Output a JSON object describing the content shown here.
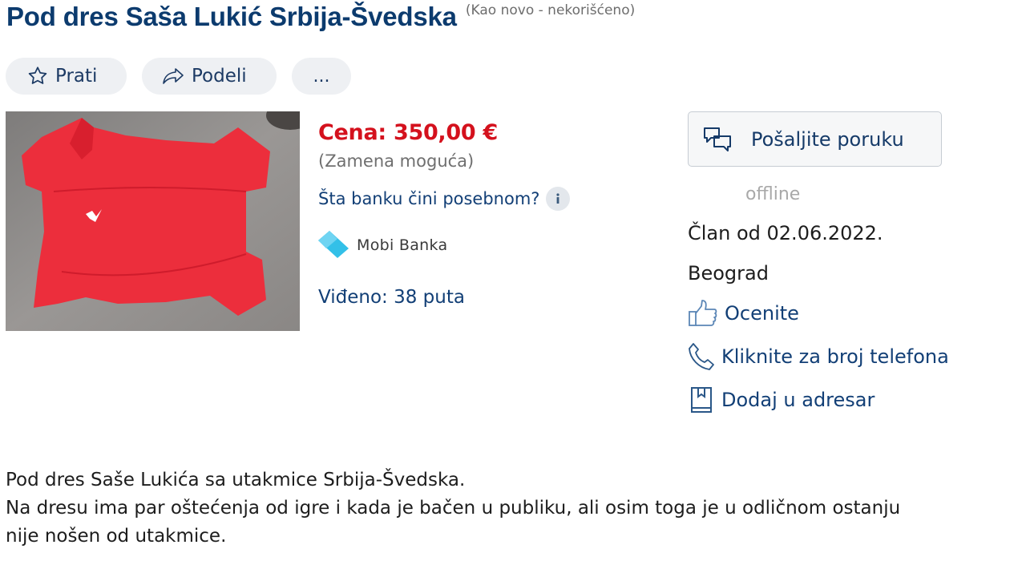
{
  "listing": {
    "title": "Pod dres Saša Lukić Srbija-Švedska",
    "condition": "(Kao novo - nekorišćeno)",
    "price": "Cena: 350,00 €",
    "swap": "(Zamena moguća)",
    "bank_question": "Šta banku čini posebnom?",
    "bank_name": "Mobi Banka",
    "views": "Viđeno: 38 puta"
  },
  "actions": {
    "follow_label": "Prati",
    "share_label": "Podeli",
    "more_label": "..."
  },
  "seller": {
    "message_button": "Pošaljite poruku",
    "status": "offline",
    "member_since": "Član od 02.06.2022.",
    "city": "Beograd",
    "rate_label": "Ocenite",
    "phone_label": "Kliknite za broj telefona",
    "addressbook_label": "Dodaj u adresar"
  },
  "description": {
    "lines": [
      "Pod dres Saše Lukića sa utakmice Srbija-Švedska.",
      "Na dresu ima par oštećenja od igre i kada je bačen u publiku, ali osim toga je u odličnom ostanju",
      "nije nošen od utakmice."
    ]
  },
  "colors": {
    "title": "#0c3b6e",
    "price": "#d4111d",
    "link": "#123f76",
    "muted": "#6f6f6f"
  },
  "icons": [
    "star-icon",
    "share-arrow-icon",
    "chat-bubbles-icon",
    "info-icon",
    "bank-logo-icon",
    "thumbs-up-icon",
    "phone-icon",
    "bookmark-icon"
  ]
}
